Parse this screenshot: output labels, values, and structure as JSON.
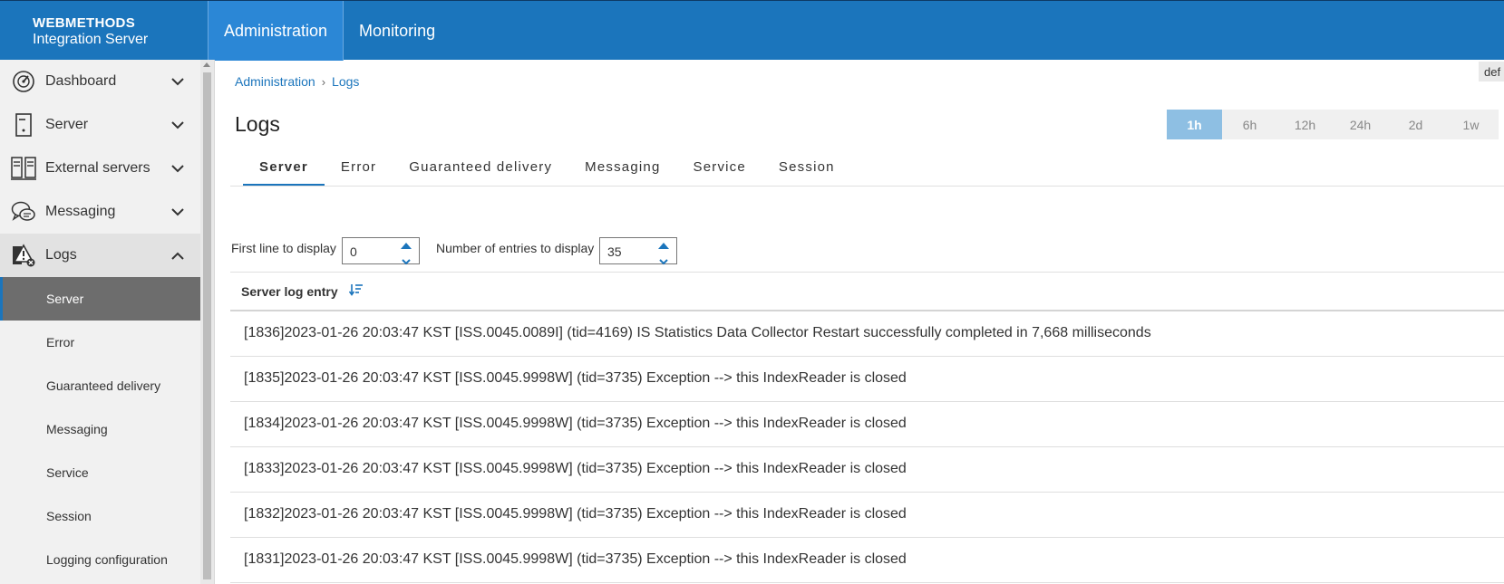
{
  "brand": {
    "line1": "WEBMETHODS",
    "line2": "Integration Server"
  },
  "topnav": [
    {
      "label": "Administration",
      "active": true
    },
    {
      "label": "Monitoring",
      "active": false
    }
  ],
  "sidebar": {
    "items": [
      {
        "label": "Dashboard",
        "icon": "dashboard-gauge-icon",
        "expanded": false
      },
      {
        "label": "Server",
        "icon": "server-icon",
        "expanded": false
      },
      {
        "label": "External servers",
        "icon": "external-servers-icon",
        "expanded": false
      },
      {
        "label": "Messaging",
        "icon": "messaging-icon",
        "expanded": false
      },
      {
        "label": "Logs",
        "icon": "logs-warning-icon",
        "expanded": true
      }
    ],
    "sub_items": [
      {
        "label": "Server",
        "active": true
      },
      {
        "label": "Error",
        "active": false
      },
      {
        "label": "Guaranteed delivery",
        "active": false
      },
      {
        "label": "Messaging",
        "active": false
      },
      {
        "label": "Service",
        "active": false
      },
      {
        "label": "Session",
        "active": false
      },
      {
        "label": "Logging configuration",
        "active": false
      }
    ]
  },
  "breadcrumb": {
    "root": "Administration",
    "current": "Logs"
  },
  "corner_tag": "def",
  "page_title": "Logs",
  "time_range": {
    "options": [
      "1h",
      "6h",
      "12h",
      "24h",
      "2d",
      "1w"
    ],
    "selected": "1h"
  },
  "tabs": [
    {
      "label": "Server",
      "active": true
    },
    {
      "label": "Error",
      "active": false
    },
    {
      "label": "Guaranteed delivery",
      "active": false
    },
    {
      "label": "Messaging",
      "active": false
    },
    {
      "label": "Service",
      "active": false
    },
    {
      "label": "Session",
      "active": false
    }
  ],
  "controls": {
    "first_line_label": "First line to display",
    "first_line_value": "0",
    "entries_label": "Number of entries to display",
    "entries_value": "35"
  },
  "table": {
    "header": "Server log entry",
    "rows": [
      "[1836]2023-01-26 20:03:47 KST [ISS.0045.0089I] (tid=4169) IS Statistics Data Collector Restart successfully completed in 7,668 milliseconds",
      "[1835]2023-01-26 20:03:47 KST [ISS.0045.9998W] (tid=3735) Exception --> this IndexReader is closed",
      "[1834]2023-01-26 20:03:47 KST [ISS.0045.9998W] (tid=3735) Exception --> this IndexReader is closed",
      "[1833]2023-01-26 20:03:47 KST [ISS.0045.9998W] (tid=3735) Exception --> this IndexReader is closed",
      "[1832]2023-01-26 20:03:47 KST [ISS.0045.9998W] (tid=3735) Exception --> this IndexReader is closed",
      "[1831]2023-01-26 20:03:47 KST [ISS.0045.9998W] (tid=3735) Exception --> this IndexReader is closed"
    ]
  },
  "colors": {
    "header_bg": "#1b75bc",
    "accent": "#1b75bc",
    "active_range": "#8ebfe3",
    "active_sub_item": "#6d6d6d"
  }
}
